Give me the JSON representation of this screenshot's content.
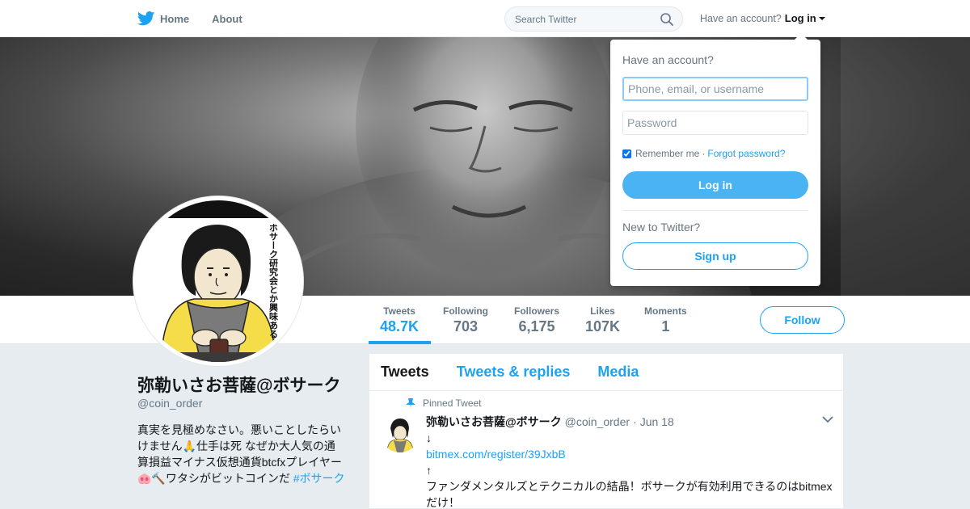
{
  "nav": {
    "home_label": "Home",
    "about_label": "About",
    "search_placeholder": "Search Twitter",
    "account_prompt": "Have an account?",
    "login_label": "Log in"
  },
  "profile": {
    "name": "弥勒いさお菩薩@ボサーク",
    "handle": "@coin_order",
    "bio_text": "真実を見極めなさい。悪いことしたらいけません🙏仕手は死 なぜか大人気の通算損益マイナス仮想通貨btcfxプレイヤー🐽🔨ワタシがビットコインだ ",
    "bio_hashtag": "#ボサーク",
    "follow_label": "Follow",
    "avatar_caption": "ボサーク研究会とか興味ある？"
  },
  "stats": [
    {
      "label": "Tweets",
      "value": "48.7K"
    },
    {
      "label": "Following",
      "value": "703"
    },
    {
      "label": "Followers",
      "value": "6,175"
    },
    {
      "label": "Likes",
      "value": "107K"
    },
    {
      "label": "Moments",
      "value": "1"
    }
  ],
  "timeline": {
    "tabs": [
      "Tweets",
      "Tweets & replies",
      "Media"
    ],
    "pinned_label": "Pinned Tweet",
    "tweet": {
      "name": "弥勒いさお菩薩@ボサーク",
      "handle": "@coin_order",
      "time": "Jun 18",
      "line1": "↓",
      "link": "bitmex.com/register/39JxbB",
      "line3": "↑",
      "line4": "ファンダメンタルズとテクニカルの結晶！ボサークが有効利用できるのはbitmexだけ！"
    }
  },
  "login_dropdown": {
    "title": "Have an account?",
    "username_placeholder": "Phone, email, or username",
    "password_placeholder": "Password",
    "remember_label": "Remember me",
    "separator": "·",
    "forgot_label": "Forgot password?",
    "login_button": "Log in",
    "new_prompt": "New to Twitter?",
    "signup_button": "Sign up"
  },
  "colors": {
    "accent": "#1da1f2",
    "login_button": "#4ab3f4",
    "background": "#e6ecf0"
  }
}
